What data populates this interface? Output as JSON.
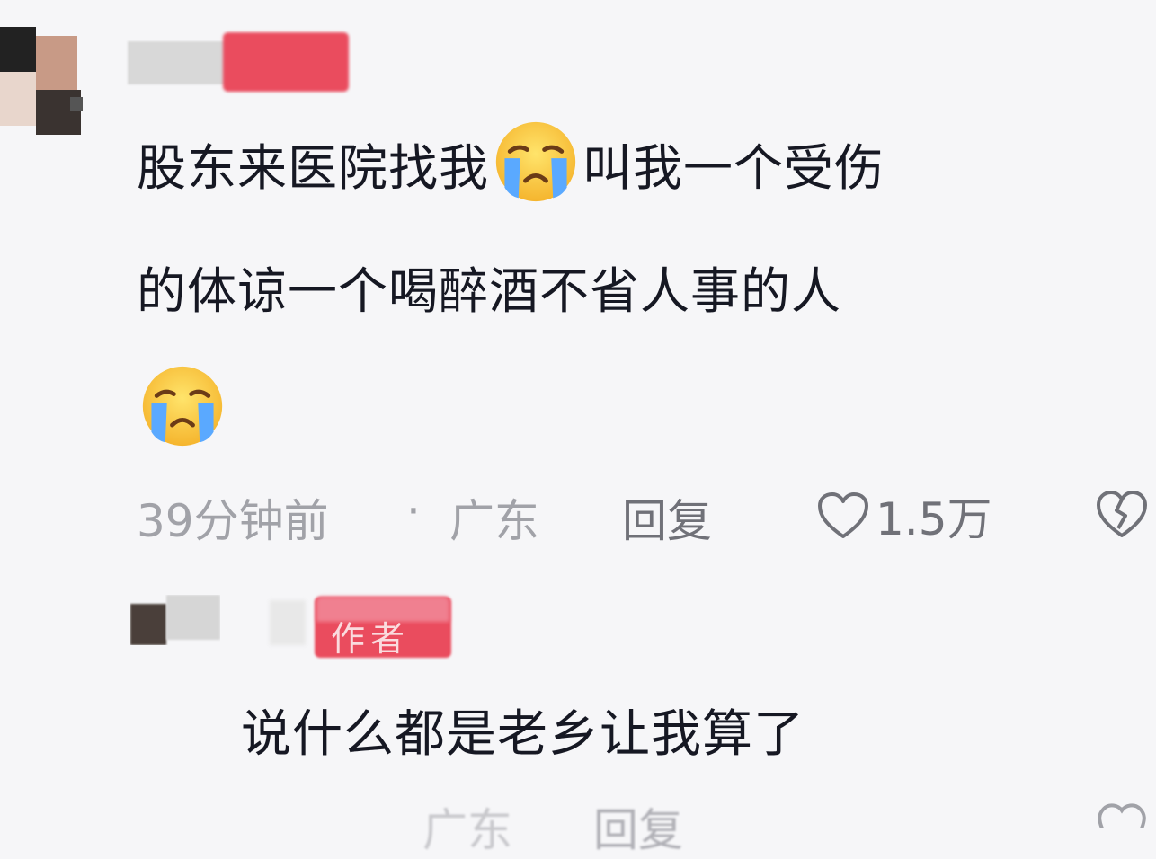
{
  "comment1": {
    "line1a": "股东来医院找我",
    "line1b": "叫我一个受伤",
    "line2": "的体谅一个喝醉酒不省人事的人",
    "emoji": "crying-face",
    "time": "39分钟前",
    "separator": "·",
    "location": "广东",
    "reply": "回复",
    "likes": "1.5万"
  },
  "reply1": {
    "badge": "作者",
    "text": "说什么都是老乡让我算了",
    "location": "广东",
    "reply": "回复"
  },
  "colors": {
    "badge": "#ea4c5e",
    "text": "#161823",
    "meta": "#a1a2a8",
    "background": "#f6f6f8"
  }
}
